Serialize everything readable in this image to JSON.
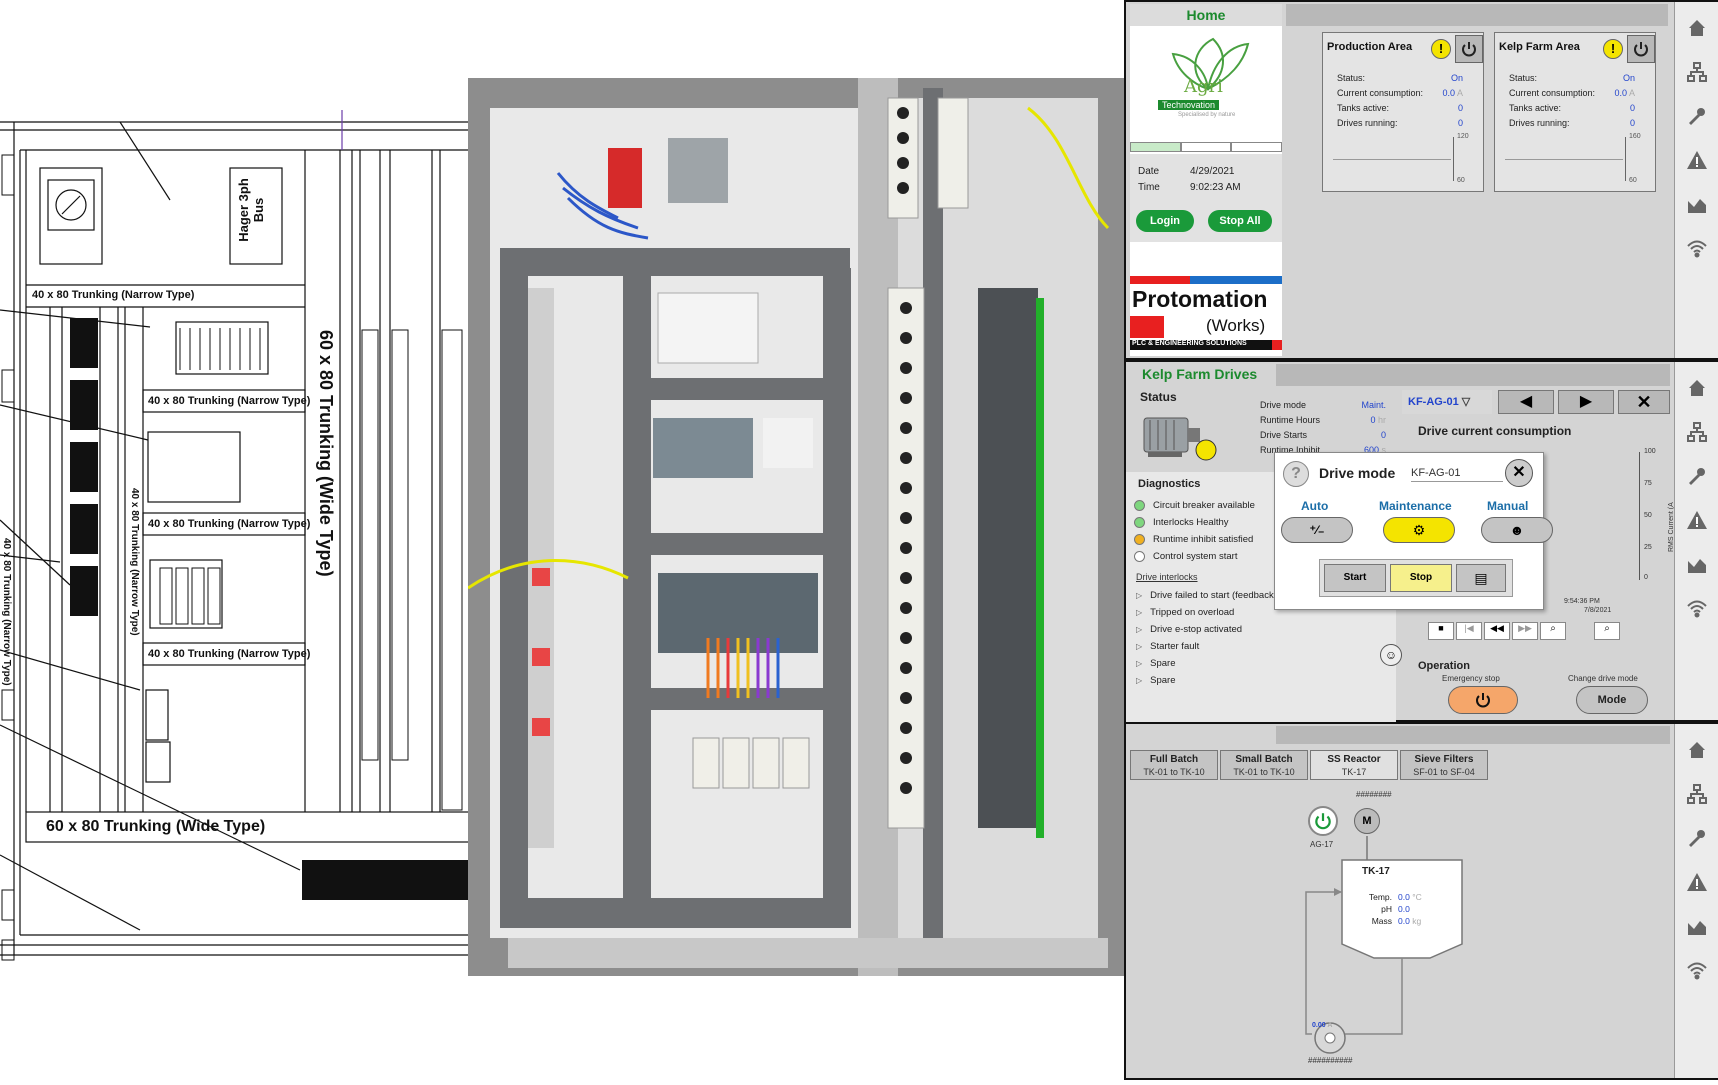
{
  "schematic": {
    "trunking_narrow": "40 x 80 Trunking (Narrow Type)",
    "trunking_narrow_vertical": "40 x 80 Trunking (Narrow Type)",
    "trunking_wide_vertical": "60 x 80 Trunking (Wide Type)",
    "trunking_wide_bottom": "60 x 80 Trunking (Wide Type)",
    "bus_label": "Hager 3ph Bus"
  },
  "home_screen": {
    "title": "Home",
    "logo_name": "Agri",
    "logo_tag": "Technovation",
    "logo_slogan": "Specialised by nature",
    "date_label": "Date",
    "date_value": "4/29/2021",
    "time_label": "Time",
    "time_value": "9:02:23 AM",
    "login_label": "Login",
    "stop_all_label": "Stop All",
    "brand_top": "Protomation",
    "brand_works": "Works",
    "brand_sub": "PLC & ENGINEERING SOLUTIONS",
    "areas": [
      {
        "title": "Production Area",
        "rows": [
          {
            "label": "Status:",
            "value": "On"
          },
          {
            "label": "Current consumption:",
            "value": "0.0"
          },
          {
            "label": "Tanks active:",
            "value": "0"
          },
          {
            "label": "Drives running:",
            "value": "0"
          }
        ],
        "unit": "A",
        "gauge_top": "120",
        "gauge_bottom": "60"
      },
      {
        "title": "Kelp Farm Area",
        "rows": [
          {
            "label": "Status:",
            "value": "On"
          },
          {
            "label": "Current consumption:",
            "value": "0.0"
          },
          {
            "label": "Tanks active:",
            "value": "0"
          },
          {
            "label": "Drives running:",
            "value": "0"
          }
        ],
        "unit": "A",
        "gauge_top": "160",
        "gauge_bottom": "60"
      }
    ]
  },
  "drives_screen": {
    "title": "Kelp Farm Drives",
    "status_label": "Status",
    "status_rows": [
      {
        "label": "Drive mode",
        "value": "Maint."
      },
      {
        "label": "Runtime Hours",
        "value": "0"
      },
      {
        "label": "Drive Starts",
        "value": "0"
      },
      {
        "label": "Runtime Inhibit",
        "value": "600"
      }
    ],
    "hours_unit": "hr",
    "inhibit_unit": "s",
    "diagnostics_label": "Diagnostics",
    "diag_rows": [
      {
        "label": "Circuit breaker available",
        "color": "#7ed67e"
      },
      {
        "label": "Interlocks Healthy",
        "color": "#7ed67e"
      },
      {
        "label": "Runtime inhibit satisfied",
        "color": "#f0b020"
      },
      {
        "label": "Control system start",
        "color": "#ffffff"
      }
    ],
    "interlocks_label": "Drive interlocks",
    "interlock_rows": [
      "Drive failed to start (feedback no",
      "Tripped on overload",
      "Drive e-stop activated",
      "Starter fault",
      "Spare",
      "Spare"
    ],
    "drive_selector": "KF-AG-01",
    "chart_title": "Drive current consumption",
    "chart_axis_label": "RMS Current (A",
    "chart_ticks": [
      "100",
      "75",
      "50",
      "25",
      "0"
    ],
    "chart_time": "9:54:36 PM",
    "chart_date": "7/8/2021",
    "chart_time_left": "PM",
    "operation_label": "Operation",
    "estop_label": "Emergency stop",
    "change_mode_label": "Change drive mode",
    "mode_button": "Mode",
    "popup": {
      "title": "Drive mode",
      "drive": "KF-AG-01",
      "modes": [
        "Auto",
        "Maintenance",
        "Manual"
      ],
      "start_label": "Start",
      "stop_label": "Stop"
    }
  },
  "batch_screen": {
    "tabs": [
      {
        "label": "Full Batch",
        "sub": "TK-01 to TK-10"
      },
      {
        "label": "Small Batch",
        "sub": "TK-01 to TK-10"
      },
      {
        "label": "SS Reactor",
        "sub": "TK-17"
      },
      {
        "label": "Sieve Filters",
        "sub": "SF-01 to SF-04"
      }
    ],
    "tank_name": "TK-17",
    "tank_header": "########",
    "agitator_label": "AG-17",
    "motor_label": "M",
    "tank_rows": [
      {
        "label": "Temp.",
        "value": "0.0",
        "unit": "°C"
      },
      {
        "label": "pH",
        "value": "0.0",
        "unit": ""
      },
      {
        "label": "Mass",
        "value": "0.0",
        "unit": "kg"
      }
    ],
    "pump_value": "0.00",
    "pump_unit": "A",
    "pump_footer": "##########"
  },
  "colors": {
    "accent_green": "#1a9a3a",
    "header_green": "#1c8a2e",
    "warning_yellow": "#f4e400",
    "estop_orange": "#f5a66a"
  }
}
